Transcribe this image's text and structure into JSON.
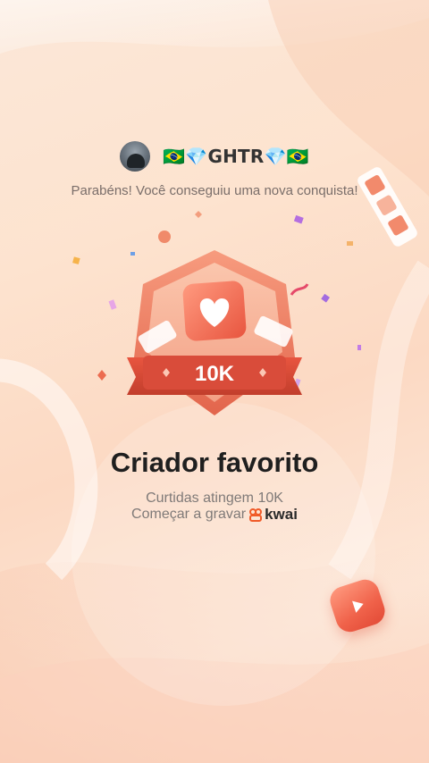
{
  "header": {
    "username": "🇧🇷💎GHTR💎🇧🇷",
    "avatar_icon": "user-avatar"
  },
  "achievement": {
    "congrats_text": "Parabéns! Você conseguiu uma nova conquista!",
    "badge_value": "10K",
    "badge_icon": "heart-icon",
    "title": "Criador favorito",
    "line1": "Curtidas atingem 10K",
    "line2_prefix": "Começar a gravar",
    "brand": "kwai"
  },
  "colors": {
    "accent": "#e8553f",
    "badge_red": "#d94c3a",
    "background": "#fde3cf"
  }
}
